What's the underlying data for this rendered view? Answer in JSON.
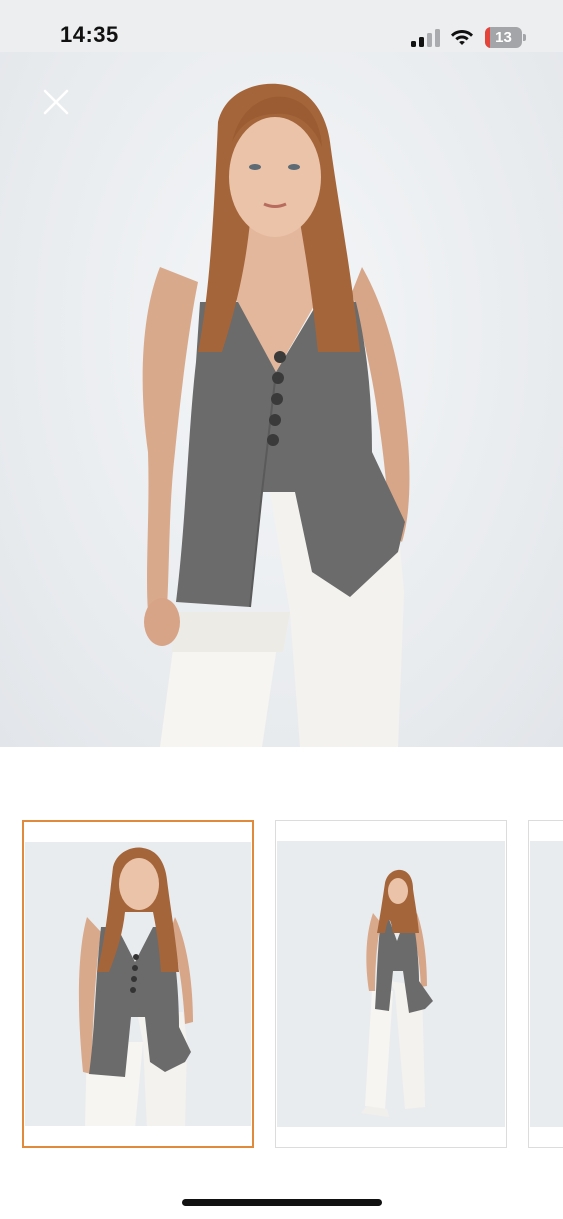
{
  "status_bar": {
    "time": "14:35",
    "battery_level": "13",
    "icons": [
      "cellular-signal-icon",
      "wifi-icon",
      "battery-icon"
    ],
    "battery_color": "#e5443a"
  },
  "viewer": {
    "close_icon": "close-icon",
    "main_image": "model-wearing-grey-vest-and-white-trousers",
    "selected_thumbnail": 1,
    "selected_color": "#e08a3c"
  },
  "thumbnails": [
    {
      "image": "model-front-closeup"
    },
    {
      "image": "model-full-length"
    },
    {
      "image": "model-partial-next"
    }
  ]
}
